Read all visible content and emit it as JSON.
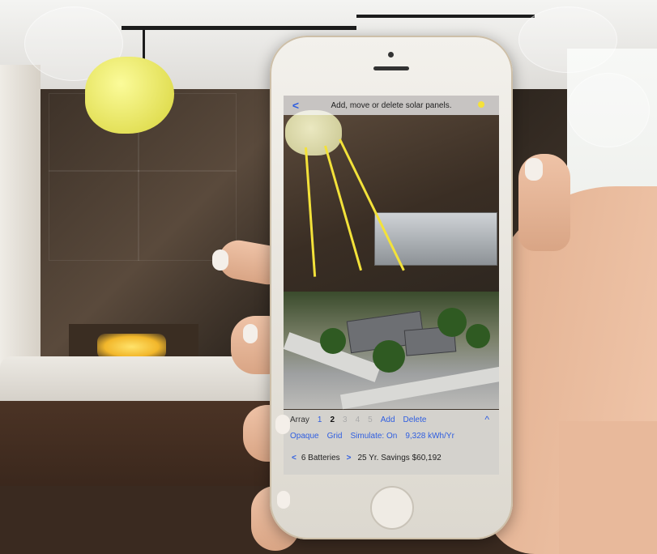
{
  "app": {
    "header": {
      "back_label": "<",
      "title": "Add, move or delete solar panels."
    },
    "array_row": {
      "array_label": "Array",
      "array_numbers": [
        "1",
        "2",
        "3",
        "4",
        "5"
      ],
      "selected_array": "2",
      "add_label": "Add",
      "delete_label": "Delete",
      "collapse_label": "^"
    },
    "options_row": {
      "opaque_label": "Opaque",
      "grid_label": "Grid",
      "simulate_label": "Simulate: On",
      "energy_value": "9,328 kWh/Yr"
    },
    "battery_row": {
      "prev_label": "<",
      "batteries_label": "6 Batteries",
      "next_label": ">",
      "savings_label": "25 Yr. Savings $60,192"
    }
  },
  "colors": {
    "link_blue": "#2f5ee0",
    "sun_ray_yellow": "#f3e23a",
    "phone_body": "#f3f1ec"
  }
}
